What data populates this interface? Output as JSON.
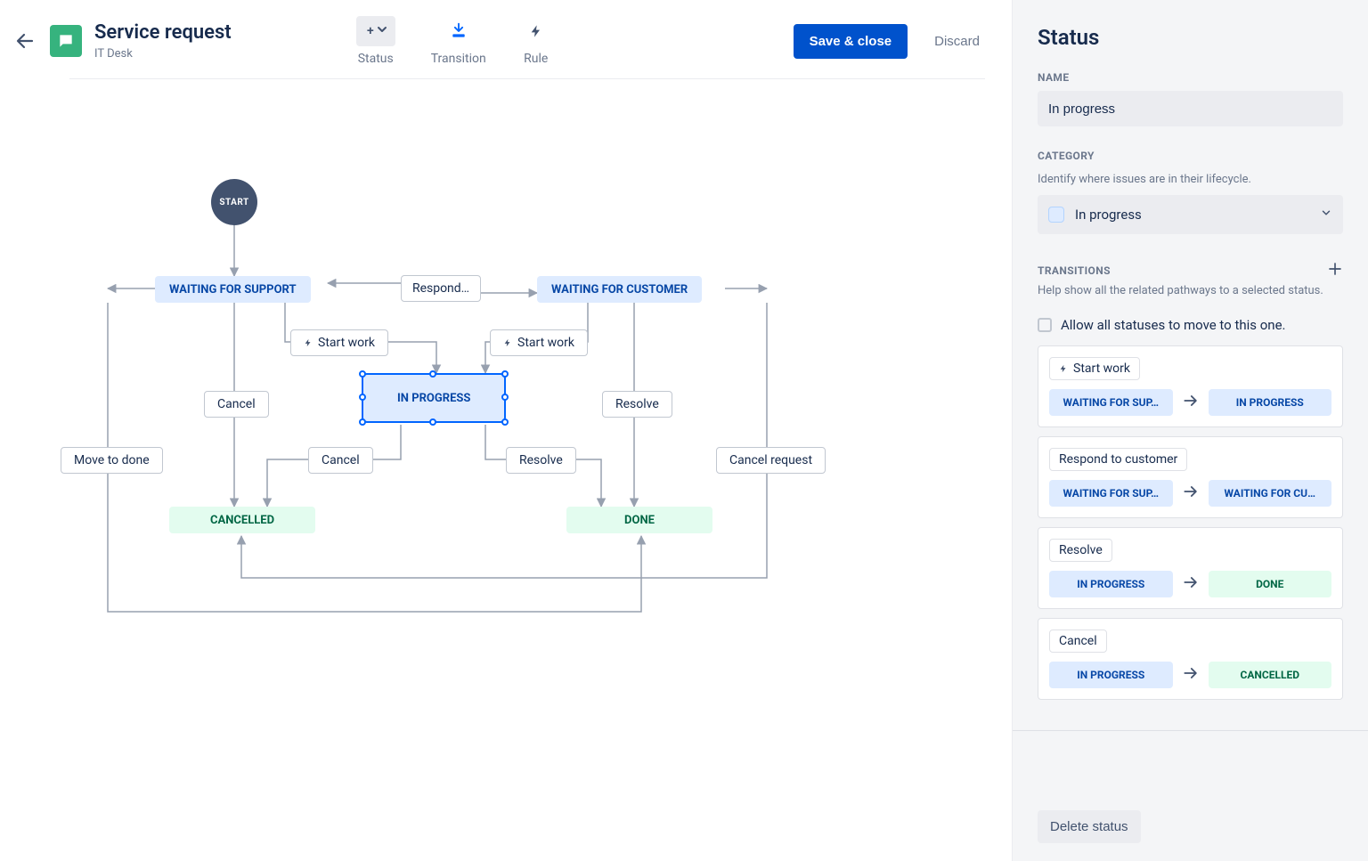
{
  "header": {
    "title": "Service request",
    "subtitle": "IT Desk",
    "tools": {
      "status": "Status",
      "transition": "Transition",
      "rule": "Rule"
    },
    "save": "Save & close",
    "discard": "Discard"
  },
  "canvas": {
    "start": "START",
    "nodes": {
      "waiting_support": "WAITING FOR SUPPORT",
      "waiting_customer": "WAITING FOR CUSTOMER",
      "in_progress": "IN PROGRESS",
      "cancelled": "CANCELLED",
      "done": "DONE"
    },
    "labels": {
      "respond": "Respond…",
      "start_work_1": "Start work",
      "start_work_2": "Start work",
      "cancel_1": "Cancel",
      "cancel_2": "Cancel",
      "resolve_1": "Resolve",
      "resolve_2": "Resolve",
      "move_to_done": "Move to done",
      "cancel_request": "Cancel request"
    }
  },
  "sidebar": {
    "title": "Status",
    "name_label": "NAME",
    "name_value": "In progress",
    "category_label": "CATEGORY",
    "category_help": "Identify where issues are in their lifecycle.",
    "category_value": "In progress",
    "transitions_label": "TRANSITIONS",
    "transitions_help": "Help show all the related pathways to a selected status.",
    "allow_all": "Allow all statuses to move to this one.",
    "transitions": [
      {
        "name": "Start work",
        "rule": true,
        "from": "WAITING FOR SUP…",
        "from_type": "blue",
        "to": "IN PROGRESS",
        "to_type": "blue"
      },
      {
        "name": "Respond to customer",
        "rule": false,
        "from": "WAITING FOR SUP…",
        "from_type": "blue",
        "to": "WAITING FOR CU…",
        "to_type": "blue"
      },
      {
        "name": "Resolve",
        "rule": false,
        "from": "IN PROGRESS",
        "from_type": "blue",
        "to": "DONE",
        "to_type": "green"
      },
      {
        "name": "Cancel",
        "rule": false,
        "from": "IN PROGRESS",
        "from_type": "blue",
        "to": "CANCELLED",
        "to_type": "green"
      }
    ],
    "delete": "Delete status"
  }
}
